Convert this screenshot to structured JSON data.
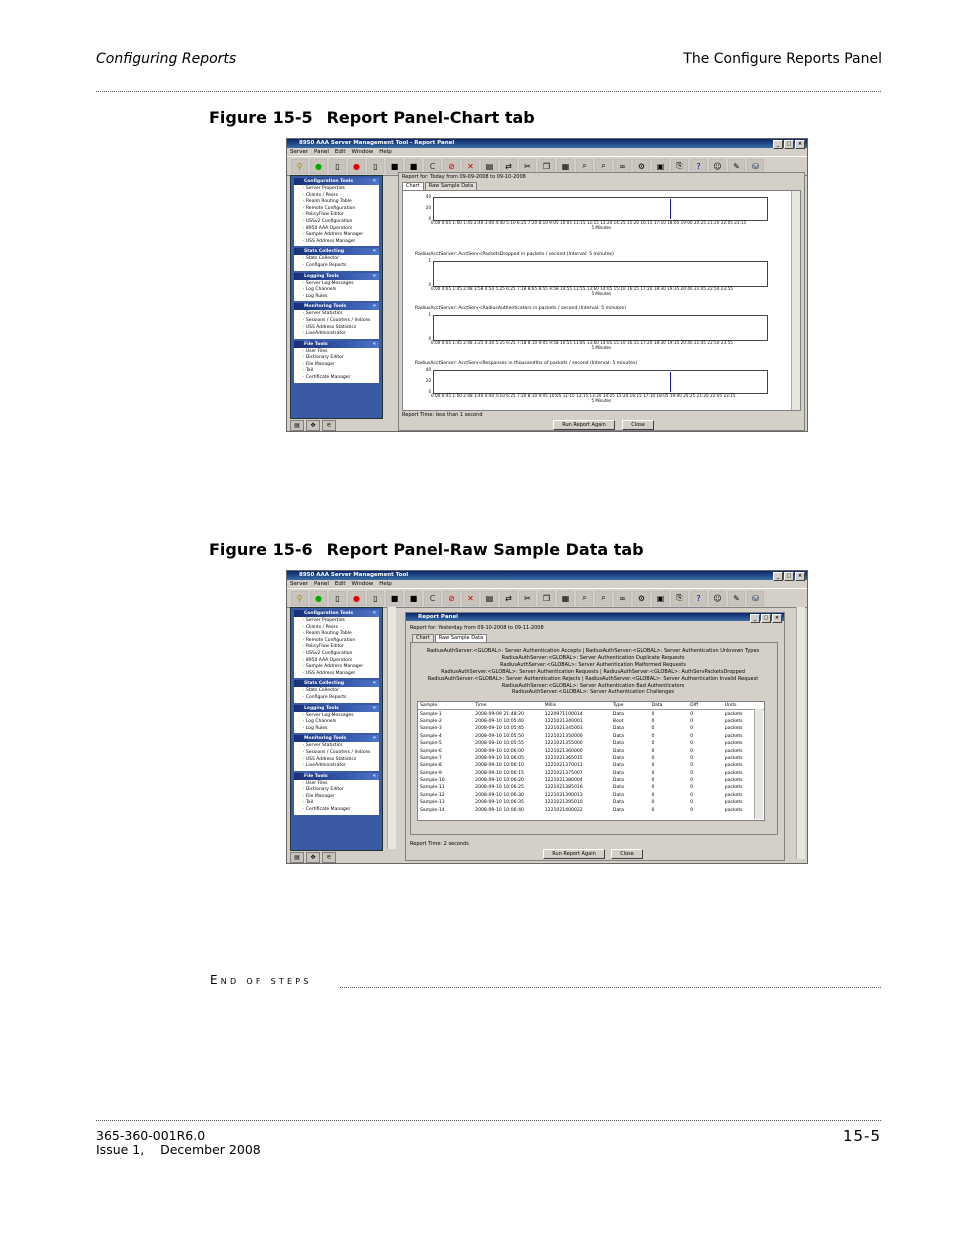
{
  "header": {
    "left": "Configuring Reports",
    "right": "The Configure Reports Panel"
  },
  "figure1": {
    "number": "Figure 15-5",
    "title": "Report Panel-Chart tab",
    "screenshot": {
      "window_title": "8950 AAA Server Management Tool - Report Panel",
      "menu": [
        "Server",
        "Panel",
        "Edit",
        "Window",
        "Help"
      ],
      "report_for": "Report for: Today from 09-09-2008 to 09-10-2008",
      "tabs": [
        "Chart",
        "Raw Sample Data"
      ],
      "active_tab": "Chart",
      "charts": [
        {
          "title": "",
          "yticks": [
            "40",
            "20",
            "0"
          ],
          "xticks": "0:00 0:65 1:00 1:45 2:40 3:40 4:40 5:10 6:25 7:20 8:10 9:05 10:05 11:15 12:15 13:20 14:25 15:20 16:15 17:10 18:05 19:00 20:25 21:20 22:05 23:15",
          "xlabel": "5 Minutes",
          "spike_hour": 17.1
        },
        {
          "title": "RadiusAcctServer: AcctServ<PacketsDropped in packets / second (Interval: 5 minutes)",
          "yticks": [
            "1",
            "0"
          ],
          "xticks": "0:00 0:65 1:45 2:48 3:58 4:50 5:25 6:25 7:18 8:65 8:55 9:58 10:55 11:55 13:60 14:05 15:10 16:15 17:20 18:30 19:35 20:40 21:45 22:50 23:55",
          "xlabel": "5 Minutes",
          "spike_hour": null
        },
        {
          "title": "RadiusAcctServer: AcctServ<RadiusAuthenticators in packets / second (Interval: 5 minutes)",
          "yticks": [
            "1",
            "0"
          ],
          "xticks": "0:00 0:65 1:45 2:48 3:25 4:30 5:25 6:25 7:18 8:10 9:05 9:58 10:55 11:85 13:60 14:05 15:10 16:15 17:20 18:30 19:35 20:40 21:45 22:50 23:55",
          "xlabel": "5 Minutes",
          "spike_hour": null
        },
        {
          "title": "RadiusAcctServer: AcctServ<Responses in thousandths of packets / second (Interval: 5 minutes)",
          "yticks": [
            "40",
            "20",
            "0"
          ],
          "xticks": "0:00 0:45 1:00 2:48 3:40 4:40 5:10 6:25 7:20 8:10 9:05 10:05 11:15 12:15 13:20 14:25 15:20 16:15 17:10 18:05 19:00 20:25 21:20 22:05 23:15",
          "xlabel": "5 Minutes",
          "spike_hour": 17.1
        }
      ],
      "report_time": "Report Time: less than 1 second",
      "buttons": {
        "run": "Run Report Again",
        "close": "Close"
      }
    }
  },
  "figure2": {
    "number": "Figure 15-6",
    "title": "Report Panel-Raw Sample Data tab",
    "screenshot": {
      "window_title": "8950 AAA Server Management Tool",
      "menu": [
        "Server",
        "Panel",
        "Edit",
        "Window",
        "Help"
      ],
      "panel_title": "Report Panel",
      "report_for": "Report for: Yesterday from 09-10-2008 to 09-11-2008",
      "tabs": [
        "Chart",
        "Raw Sample Data"
      ],
      "active_tab": "Raw Sample Data",
      "stat_headers": [
        "RadiusAuthServer:<GLOBAL>: Server Authentication Accepts | RadiusAuthServer:<GLOBAL>: Server Authentication Unknown Types",
        "RadiusAuthServer:<GLOBAL>: Server Authentication Duplicate Requests",
        "RadiusAuthServer:<GLOBAL>: Server Authentication Malformed Requests",
        "RadiusAuthServer:<GLOBAL>: Server Authentication Requests | RadiusAuthServer:<GLOBAL>: AuthServPacketsDropped",
        "RadiusAuthServer:<GLOBAL>: Server Authentication Rejects | RadiusAuthServer:<GLOBAL>: Server Authentication Invalid Request",
        "RadiusAuthServer:<GLOBAL>: Server Authentication Bad Authenticators",
        "RadiusAuthServer:<GLOBAL>: Server Authentication Challenges"
      ],
      "columns": [
        "Sample",
        "Time",
        "Millis",
        "Type",
        "Data",
        "Diff",
        "Units"
      ],
      "rows": [
        [
          "Sample-1",
          "2008-09-09 21:48:20",
          "1220971100014",
          "Data",
          "0",
          "0",
          "packets"
        ],
        [
          "Sample-2",
          "2008-09-10 10:05:40",
          "1221021340001",
          "Boot",
          "0",
          "0",
          "packets"
        ],
        [
          "Sample-3",
          "2008-09-10 10:05:45",
          "1221021345001",
          "Data",
          "0",
          "0",
          "packets"
        ],
        [
          "Sample-4",
          "2008-09-10 10:05:50",
          "1221021350000",
          "Data",
          "0",
          "0",
          "packets"
        ],
        [
          "Sample-5",
          "2008-09-10 10:05:55",
          "1221021355000",
          "Data",
          "0",
          "0",
          "packets"
        ],
        [
          "Sample-6",
          "2008-09-10 10:06:00",
          "1221021360000",
          "Data",
          "0",
          "0",
          "packets"
        ],
        [
          "Sample-7",
          "2008-09-10 10:06:05",
          "1221021365015",
          "Data",
          "0",
          "0",
          "packets"
        ],
        [
          "Sample-8",
          "2008-09-10 10:06:10",
          "1221021370011",
          "Data",
          "0",
          "0",
          "packets"
        ],
        [
          "Sample-9",
          "2008-09-10 10:06:15",
          "1221021375007",
          "Data",
          "0",
          "0",
          "packets"
        ],
        [
          "Sample-10",
          "2008-09-10 10:06:20",
          "1221021380004",
          "Data",
          "0",
          "0",
          "packets"
        ],
        [
          "Sample-11",
          "2008-09-10 10:06:25",
          "1221021385016",
          "Data",
          "0",
          "0",
          "packets"
        ],
        [
          "Sample-12",
          "2008-09-10 10:06:30",
          "1221021390013",
          "Data",
          "0",
          "0",
          "packets"
        ],
        [
          "Sample-13",
          "2008-09-10 10:06:35",
          "1221021395010",
          "Data",
          "0",
          "0",
          "packets"
        ],
        [
          "Sample-14",
          "2008-09-10 10:06:40",
          "1221021400022",
          "Data",
          "0",
          "0",
          "packets"
        ]
      ],
      "report_time": "Report Time: 2 seconds",
      "buttons": {
        "run": "Run Report Again",
        "close": "Close"
      }
    }
  },
  "sidebar": {
    "sections": [
      {
        "title": "Configuration Tools",
        "items": [
          "Server Properties",
          "Clients / Peers",
          "Realm Routing Table",
          "Remote Configuration",
          "PolicyFlow Editor",
          "USSv2 Configuration",
          "8950 AAA Operators",
          "Sample Address Manager",
          "USS Address Manager"
        ]
      },
      {
        "title": "Stats Collecting",
        "items": [
          "Stats Collector",
          "Configure Reports"
        ]
      },
      {
        "title": "Logging Tools",
        "items": [
          "Server Log Messages",
          "Log Channels",
          "Log Rules"
        ]
      },
      {
        "title": "Monitoring Tools",
        "items": [
          "Server Statistics",
          "Sessions / Counters / Indices",
          "USS Address Statistics",
          "LiveAdministrator"
        ]
      },
      {
        "title": "File Tools",
        "items": [
          "User Files",
          "Dictionary Editor",
          "File Manager",
          "Tail",
          "Certificate Manager"
        ]
      }
    ]
  },
  "end_of_steps": "End of steps",
  "footer": {
    "doc_number": "365-360-001R6.0",
    "issue": "Issue 1,    December 2008",
    "page": "15-5"
  }
}
